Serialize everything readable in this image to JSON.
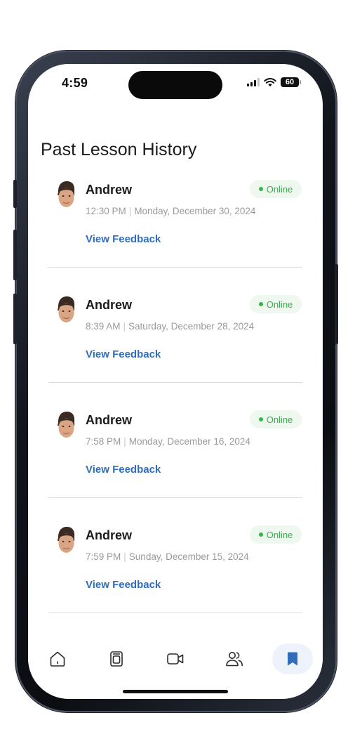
{
  "status_bar": {
    "time": "4:59",
    "battery": "60"
  },
  "page": {
    "title": "Past Lesson History"
  },
  "lessons": [
    {
      "tutor": "Andrew",
      "mode": "Online",
      "time": "12:30 PM",
      "date": "Monday, December 30, 2024",
      "action": "View Feedback"
    },
    {
      "tutor": "Andrew",
      "mode": "Online",
      "time": "8:39 AM",
      "date": "Saturday, December 28, 2024",
      "action": "View Feedback"
    },
    {
      "tutor": "Andrew",
      "mode": "Online",
      "time": "7:58 PM",
      "date": "Monday, December 16, 2024",
      "action": "View Feedback"
    },
    {
      "tutor": "Andrew",
      "mode": "Online",
      "time": "7:59 PM",
      "date": "Sunday, December 15, 2024",
      "action": "View Feedback"
    }
  ],
  "tab_bar": {
    "tabs": [
      {
        "icon": "home-icon",
        "active": false
      },
      {
        "icon": "book-icon",
        "active": false
      },
      {
        "icon": "video-camera-icon",
        "active": false
      },
      {
        "icon": "users-icon",
        "active": false
      },
      {
        "icon": "bookmark-icon",
        "active": true
      }
    ]
  },
  "colors": {
    "accent": "#2f6dbb",
    "online_green": "#38b24c",
    "online_badge_bg": "#eef8ef",
    "active_tab_bg": "#eef3fb"
  }
}
